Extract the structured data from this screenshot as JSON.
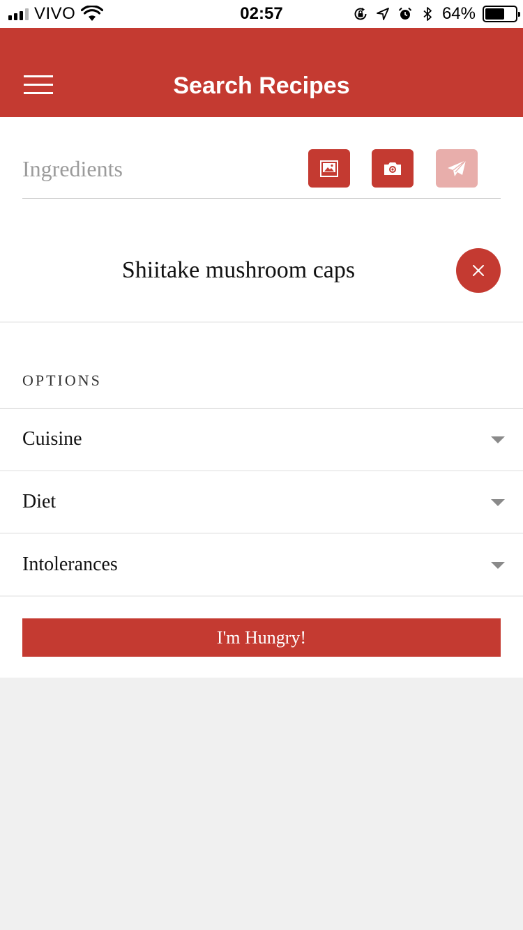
{
  "status_bar": {
    "carrier": "VIVO",
    "time": "02:57",
    "battery_percent": "64%",
    "battery_level": 0.64,
    "signal_bars": 3,
    "icons": [
      "signal-icon",
      "wifi-icon",
      "rotation-lock-icon",
      "location-icon",
      "alarm-icon",
      "bluetooth-icon",
      "battery-icon"
    ]
  },
  "header": {
    "title": "Search Recipes",
    "menu_icon": "hamburger-menu-icon",
    "background": "#c43a31"
  },
  "ingredients": {
    "placeholder": "Ingredients",
    "value": "",
    "buttons": [
      {
        "icon": "image-icon",
        "enabled": true
      },
      {
        "icon": "camera-icon",
        "enabled": true
      },
      {
        "icon": "send-icon",
        "enabled": false
      }
    ],
    "items": [
      {
        "label": "Shiitake mushroom caps",
        "remove_icon": "close-icon"
      }
    ]
  },
  "options": {
    "heading": "OPTIONS",
    "items": [
      {
        "label": "Cuisine",
        "icon": "chevron-down-icon"
      },
      {
        "label": "Diet",
        "icon": "chevron-down-icon"
      },
      {
        "label": "Intolerances",
        "icon": "chevron-down-icon"
      }
    ]
  },
  "submit": {
    "label": "I'm Hungry!"
  },
  "colors": {
    "accent": "#c43a31",
    "accent_disabled": "#e8aeab",
    "page_background": "#f0f0f0"
  }
}
